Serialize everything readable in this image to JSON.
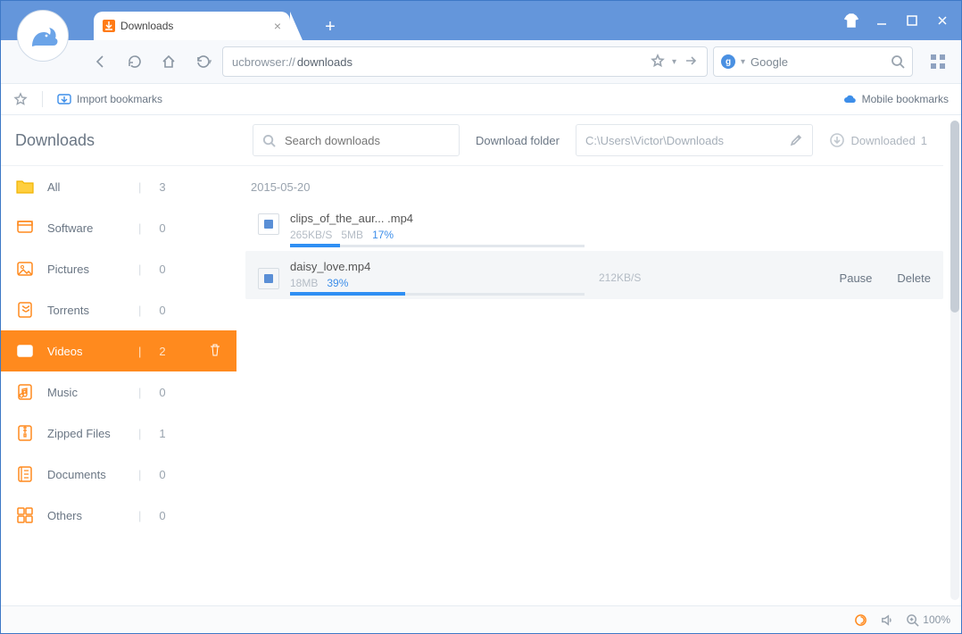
{
  "window": {
    "tab_title": "Downloads",
    "new_tab_glyph": "+",
    "address_host": "ucbrowser://",
    "address_path": "downloads",
    "search_engine_letter": "g",
    "search_engine_name": "Google",
    "apps_tooltip": "Apps"
  },
  "bookmarks_bar": {
    "star_tooltip": "Bookmark this page",
    "import_label": "Import bookmarks",
    "mobile_label": "Mobile bookmarks"
  },
  "page": {
    "title": "Downloads",
    "search_placeholder": "Search downloads",
    "folder_label": "Download folder",
    "folder_path": "C:\\Users\\Victor\\Downloads",
    "downloaded_label": "Downloaded",
    "downloaded_count": "1"
  },
  "categories": [
    {
      "id": "all",
      "label": "All",
      "count": "3",
      "icon": "folder"
    },
    {
      "id": "software",
      "label": "Software",
      "count": "0",
      "icon": "soft"
    },
    {
      "id": "pictures",
      "label": "Pictures",
      "count": "0",
      "icon": "pic"
    },
    {
      "id": "torrents",
      "label": "Torrents",
      "count": "0",
      "icon": "tor"
    },
    {
      "id": "videos",
      "label": "Videos",
      "count": "2",
      "icon": "vid",
      "active": true
    },
    {
      "id": "music",
      "label": "Music",
      "count": "0",
      "icon": "mus"
    },
    {
      "id": "zipped",
      "label": "Zipped Files",
      "count": "1",
      "icon": "zip"
    },
    {
      "id": "documents",
      "label": "Documents",
      "count": "0",
      "icon": "doc"
    },
    {
      "id": "others",
      "label": "Others",
      "count": "0",
      "icon": "oth"
    }
  ],
  "list": {
    "date": "2015-05-20",
    "items": [
      {
        "name": "clips_of_the_aur... .mp4",
        "speed": "265KB/S",
        "size": "5MB",
        "percent": "17%",
        "progress": 17
      },
      {
        "name": "daisy_love.mp4",
        "speed": "212KB/S",
        "size": "18MB",
        "percent": "39%",
        "progress": 39,
        "hovered": true,
        "actions": {
          "pause": "Pause",
          "delete": "Delete"
        }
      }
    ]
  },
  "status": {
    "zoom": "100%"
  }
}
